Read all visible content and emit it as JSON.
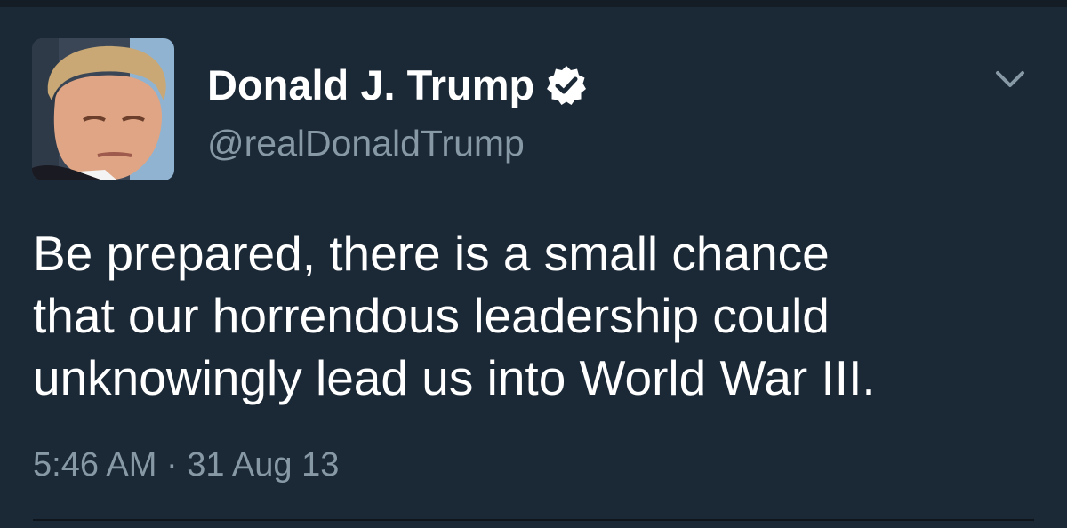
{
  "tweet": {
    "display_name": "Donald J. Trump",
    "handle": "@realDonaldTrump",
    "verified": true,
    "text": "Be prepared, there is a small chance\nthat our horrendous leadership could\nunknowingly lead us into World War III.",
    "timestamp": "5:46 AM · 31 Aug 13"
  },
  "icons": {
    "verified": "verified-badge-icon",
    "menu": "chevron-down-icon"
  },
  "colors": {
    "background": "#1b2836",
    "primary_text": "#ffffff",
    "secondary_text": "#8899a6"
  }
}
